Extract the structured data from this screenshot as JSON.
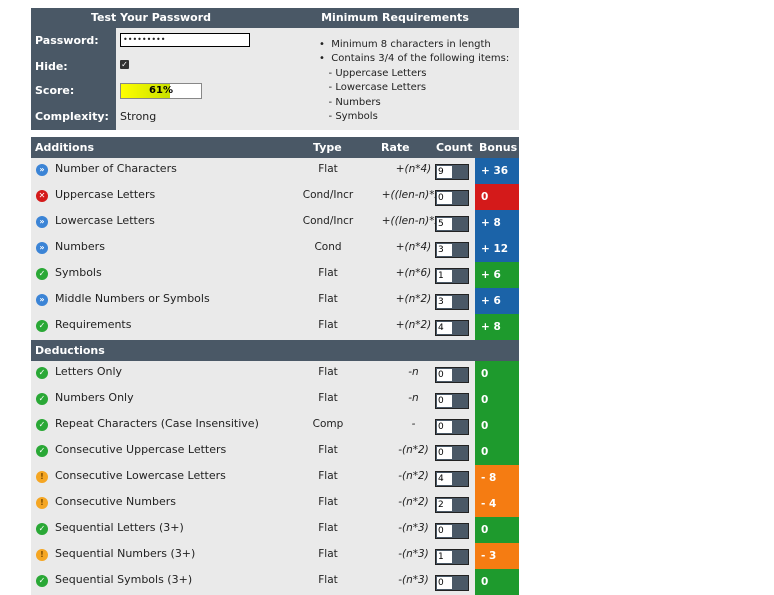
{
  "top": {
    "left_header": "Test Your Password",
    "right_header": "Minimum Requirements",
    "password_label": "Password:",
    "hide_label": "Hide:",
    "score_label": "Score:",
    "complexity_label": "Complexity:",
    "password_masked": "•••••••••",
    "hide_checked": true,
    "score_text": "61%",
    "score_fraction": 0.61,
    "complexity_value": "Strong",
    "requirements": [
      "•  Minimum 8 characters in length",
      "•  Contains 3/4 of the following items:",
      "   - Uppercase Letters",
      "   - Lowercase Letters",
      "   - Numbers",
      "   - Symbols"
    ]
  },
  "table": {
    "additions_header": {
      "title": "Additions",
      "type": "Type",
      "rate": "Rate",
      "count": "Count",
      "bonus": "Bonus"
    },
    "additions": [
      {
        "status": "info",
        "name": "Number of Characters",
        "type": "Flat",
        "rate": "+(n*4)",
        "count": "9",
        "bonus": "+ 36",
        "color": "blue"
      },
      {
        "status": "fail",
        "name": "Uppercase Letters",
        "type": "Cond/Incr",
        "rate": "+((len-n)*2)",
        "count": "0",
        "bonus": "0",
        "color": "red"
      },
      {
        "status": "info",
        "name": "Lowercase Letters",
        "type": "Cond/Incr",
        "rate": "+((len-n)*2)",
        "count": "5",
        "bonus": "+ 8",
        "color": "blue"
      },
      {
        "status": "info",
        "name": "Numbers",
        "type": "Cond",
        "rate": "+(n*4)",
        "count": "3",
        "bonus": "+ 12",
        "color": "blue"
      },
      {
        "status": "ok",
        "name": "Symbols",
        "type": "Flat",
        "rate": "+(n*6)",
        "count": "1",
        "bonus": "+ 6",
        "color": "green"
      },
      {
        "status": "info",
        "name": "Middle Numbers or Symbols",
        "type": "Flat",
        "rate": "+(n*2)",
        "count": "3",
        "bonus": "+ 6",
        "color": "blue"
      },
      {
        "status": "ok",
        "name": "Requirements",
        "type": "Flat",
        "rate": "+(n*2)",
        "count": "4",
        "bonus": "+ 8",
        "color": "green"
      }
    ],
    "deductions_header": {
      "title": "Deductions"
    },
    "deductions": [
      {
        "status": "ok",
        "name": "Letters Only",
        "type": "Flat",
        "rate": "-n",
        "count": "0",
        "bonus": "0",
        "color": "green"
      },
      {
        "status": "ok",
        "name": "Numbers Only",
        "type": "Flat",
        "rate": "-n",
        "count": "0",
        "bonus": "0",
        "color": "green"
      },
      {
        "status": "ok",
        "name": "Repeat Characters (Case Insensitive)",
        "type": "Comp",
        "rate": "-",
        "count": "0",
        "bonus": "0",
        "color": "green"
      },
      {
        "status": "ok",
        "name": "Consecutive Uppercase Letters",
        "type": "Flat",
        "rate": "-(n*2)",
        "count": "0",
        "bonus": "0",
        "color": "green"
      },
      {
        "status": "warn",
        "name": "Consecutive Lowercase Letters",
        "type": "Flat",
        "rate": "-(n*2)",
        "count": "4",
        "bonus": "- 8",
        "color": "orange"
      },
      {
        "status": "warn",
        "name": "Consecutive Numbers",
        "type": "Flat",
        "rate": "-(n*2)",
        "count": "2",
        "bonus": "- 4",
        "color": "orange"
      },
      {
        "status": "ok",
        "name": "Sequential Letters (3+)",
        "type": "Flat",
        "rate": "-(n*3)",
        "count": "0",
        "bonus": "0",
        "color": "green"
      },
      {
        "status": "warn",
        "name": "Sequential Numbers (3+)",
        "type": "Flat",
        "rate": "-(n*3)",
        "count": "1",
        "bonus": "- 3",
        "color": "orange"
      },
      {
        "status": "ok",
        "name": "Sequential Symbols (3+)",
        "type": "Flat",
        "rate": "-(n*3)",
        "count": "0",
        "bonus": "0",
        "color": "green"
      }
    ]
  },
  "colors": {
    "header_bg": "#4a5866",
    "row_bg": "#eaeaea",
    "blue": "#1b63a8",
    "red": "#d41a1a",
    "green": "#1e9a2d",
    "orange": "#f57c12"
  },
  "icons": {
    "ok": "check-circle-icon",
    "info": "info-circle-icon",
    "fail": "x-circle-icon",
    "warn": "warning-circle-icon"
  }
}
